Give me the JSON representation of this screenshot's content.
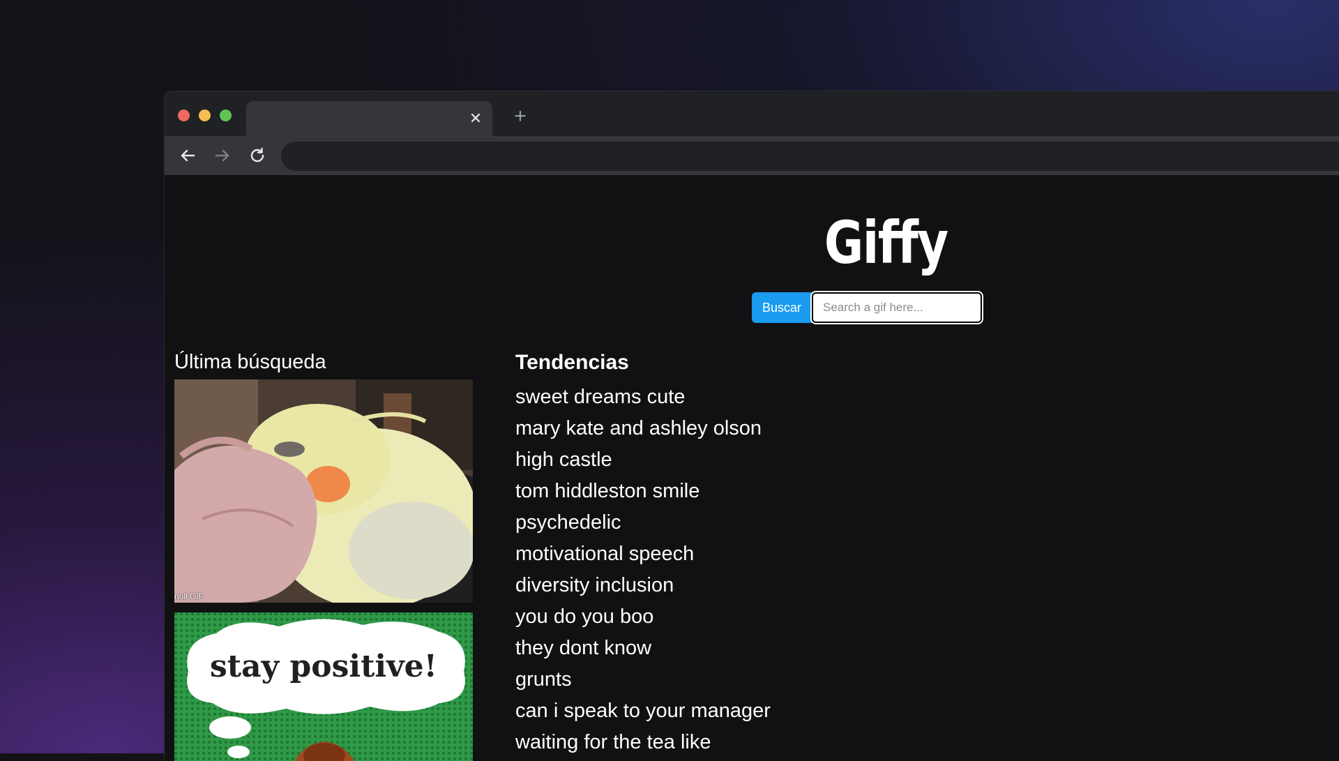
{
  "browser": {
    "tab_close_glyph": "✕",
    "new_tab_glyph": "+",
    "icons": [
      "back-arrow-icon",
      "forward-arrow-icon",
      "reload-icon"
    ]
  },
  "app": {
    "logo": "Giffy",
    "search": {
      "button_label": "Buscar",
      "placeholder": "Search a gif here...",
      "value": ""
    },
    "last_search": {
      "title": "Última búsqueda",
      "gifs": [
        {
          "caption": "null GIF"
        },
        {
          "image_text": "stay positive!"
        }
      ]
    },
    "trending": {
      "title": "Tendencias",
      "items": [
        "sweet dreams cute",
        "mary kate and ashley olson",
        "high castle",
        "tom hiddleston smile",
        "psychedelic",
        "motivational speech",
        "diversity inclusion",
        "you do you boo",
        "they dont know",
        "grunts",
        "can i speak to your manager",
        "waiting for the tea like"
      ]
    }
  },
  "colors": {
    "accent_button": "#1a9bf0",
    "page_background": "#111113",
    "traffic_red": "#ec6a5e",
    "traffic_yellow": "#f4bf4f",
    "traffic_green": "#61c554"
  }
}
